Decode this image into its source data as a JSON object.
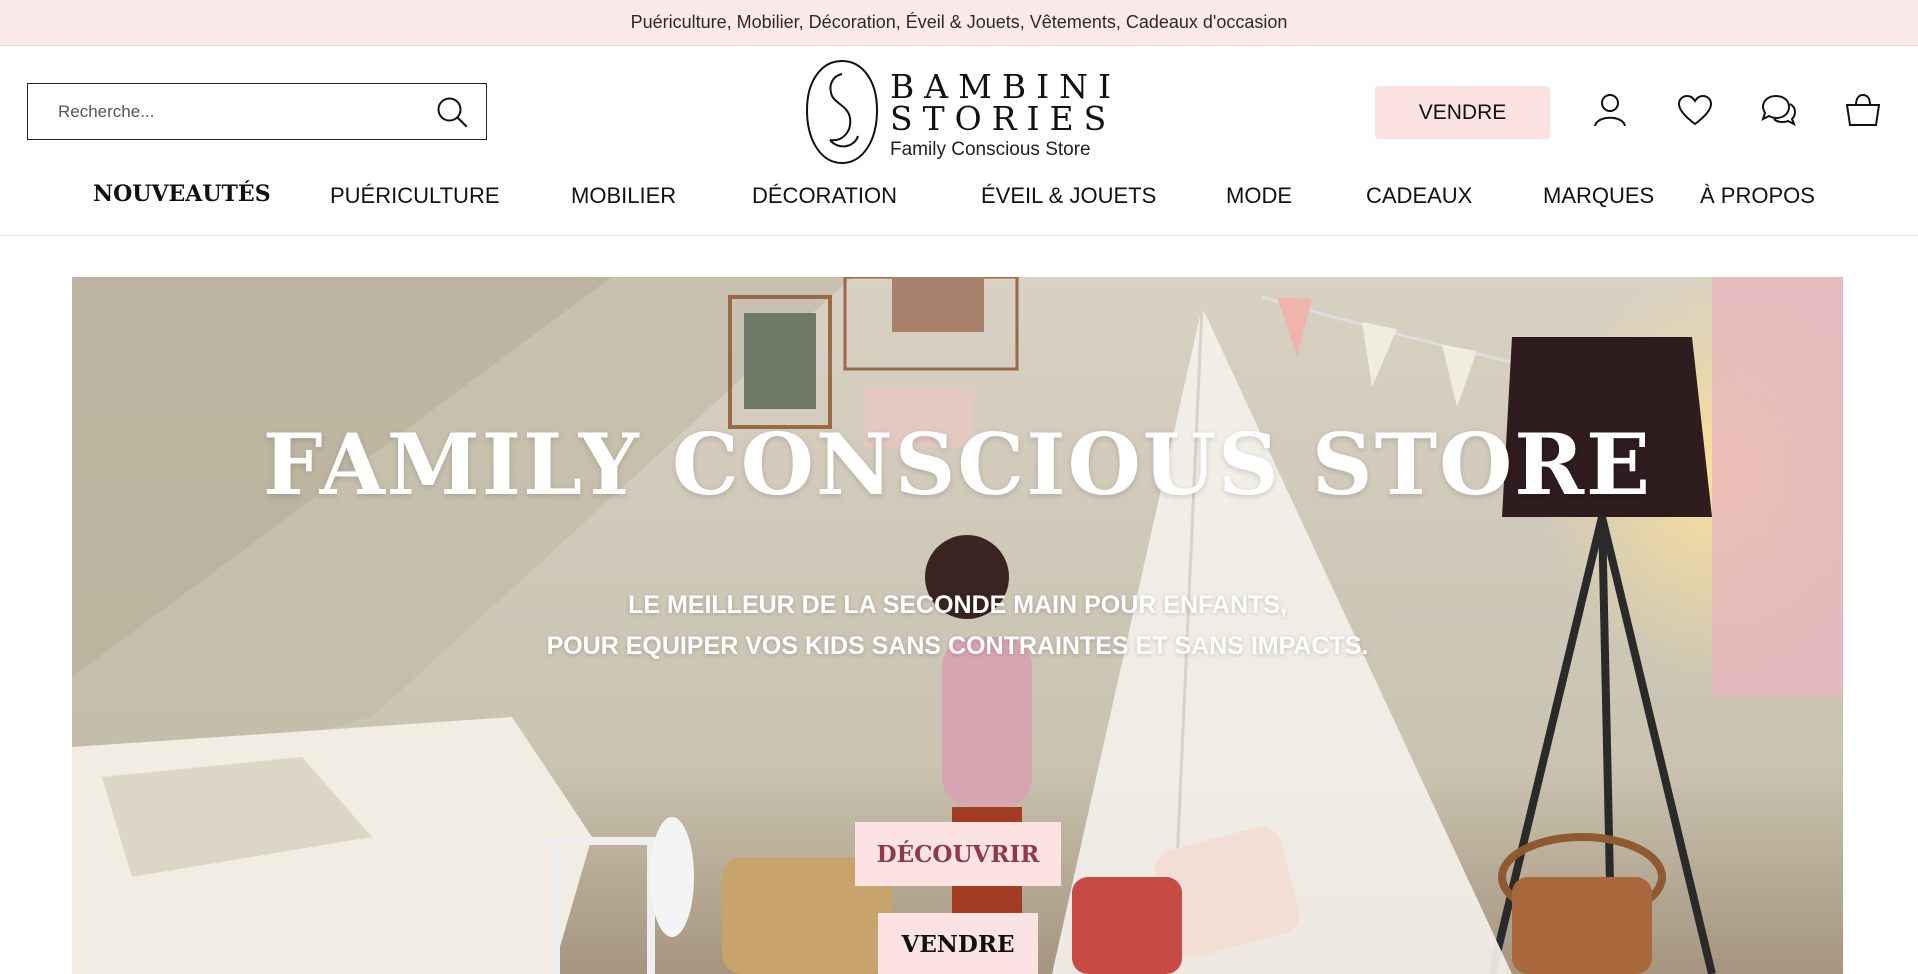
{
  "topbar": {
    "text": "Puériculture, Mobilier, Décoration, Éveil & Jouets, Vêtements, Cadeaux d'occasion"
  },
  "search": {
    "placeholder": "Recherche..."
  },
  "logo": {
    "line1": "BAMBINI",
    "line2": "STORIES",
    "tagline": "Family Conscious Store"
  },
  "header": {
    "sell_label": "VENDRE",
    "icons": [
      "account-icon",
      "heart-icon",
      "chat-icon",
      "cart-icon"
    ]
  },
  "nav": {
    "items": [
      {
        "label": "NOUVEAUTÉS"
      },
      {
        "label": "PUÉRICULTURE"
      },
      {
        "label": "MOBILIER"
      },
      {
        "label": "DÉCORATION"
      },
      {
        "label": "ÉVEIL & JOUETS"
      },
      {
        "label": "MODE"
      },
      {
        "label": "CADEAUX"
      },
      {
        "label": "MARQUES"
      },
      {
        "label": "À PROPOS"
      }
    ]
  },
  "hero": {
    "title": "FAMILY CONSCIOUS STORE",
    "subtitle_line1": "LE MEILLEUR DE LA SECONDE MAIN POUR ENFANTS,",
    "subtitle_line2": "POUR EQUIPER VOS KIDS SANS CONTRAINTES ET SANS IMPACTS.",
    "discover_label": "DÉCOUVRIR",
    "sell_label": "VENDRE"
  },
  "colors": {
    "accent_pink": "#fbe3e4",
    "topbar_bg": "#fbe9ea",
    "discover_text": "#8f3b45"
  }
}
